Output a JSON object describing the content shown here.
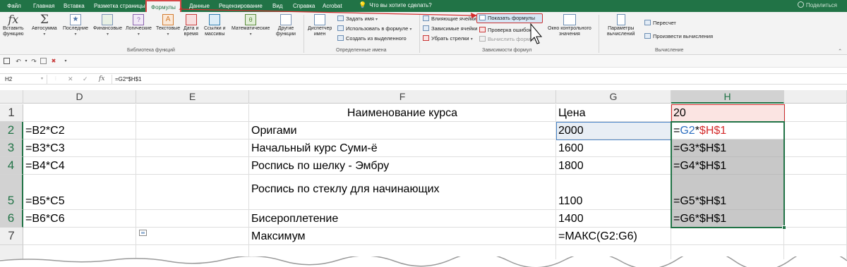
{
  "tabs": {
    "file": "Файл",
    "home": "Главная",
    "insert": "Вставка",
    "page_layout": "Разметка страницы",
    "formulas": "Формулы",
    "data": "Данные",
    "review": "Рецензирование",
    "view": "Вид",
    "help": "Справка",
    "acrobat": "Acrobat",
    "tell_me": "Что вы хотите сделать?",
    "share": "Поделиться"
  },
  "ribbon": {
    "function_library": {
      "label": "Библиотека функций",
      "insert_function": [
        "Вставить",
        "функцию"
      ],
      "autosum": [
        "Автосумма",
        ""
      ],
      "recent": [
        "Последние",
        ""
      ],
      "financial": [
        "Финансовые",
        ""
      ],
      "logical": [
        "Логические",
        ""
      ],
      "text": [
        "Текстовые",
        ""
      ],
      "datetime": [
        "Дата и",
        "время"
      ],
      "lookup": [
        "Ссылки и",
        "массивы"
      ],
      "math": [
        "Математические",
        ""
      ],
      "more": [
        "Другие",
        "функции"
      ]
    },
    "defined_names": {
      "label": "Определенные имена",
      "name_manager": [
        "Диспетчер",
        "имен"
      ],
      "define_name": "Задать имя",
      "use_in_formula": "Использовать в формуле",
      "create_from_selection": "Создать из выделенного"
    },
    "formula_auditing": {
      "label": "Зависимости формул",
      "trace_precedents": "Влияющие ячейки",
      "trace_dependents": "Зависимые ячейки",
      "remove_arrows": "Убрать стрелки",
      "show_formulas": "Показать формулы",
      "error_checking": "Проверка ошибок",
      "evaluate_formula": "Вычислить формулу",
      "watch_window": [
        "Окно контрольного",
        "значения"
      ]
    },
    "calculation": {
      "label": "Вычисление",
      "calc_options": [
        "Параметры",
        "вычислений"
      ],
      "calc_now": "Пересчет",
      "calc_sheet": "Произвести вычисления"
    }
  },
  "formula_bar": {
    "name_box": "H2",
    "fx": "fx",
    "formula": "=G2*$H$1"
  },
  "grid": {
    "columns": [
      "D",
      "E",
      "F",
      "G",
      "H"
    ],
    "rows": [
      "1",
      "2",
      "3",
      "4",
      "5",
      "6",
      "7"
    ],
    "cells": {
      "D2": "=B2*C2",
      "D3": "=B3*C3",
      "D4": "=B4*C4",
      "D5": "=B5*C5",
      "D6": "=B6*C6",
      "F1": "Наименование курса",
      "F2": "Оригами",
      "F3": "Начальный курс Суми-ё",
      "F4": "Роспись по шелку - Эмбру",
      "F5": "Роспись по стеклу для начинающих",
      "F6": "Бисероплетение",
      "F7": "Максимум",
      "G1": "Цена",
      "G2": "2000",
      "G3": "1600",
      "G4": "1800",
      "G5": "1100",
      "G6": "1400",
      "G7": "=МАКС(G2:G6)",
      "H1": "20",
      "H2": {
        "eq": "=",
        "ref1": "G2",
        "op": "*",
        "ref2": "$H$1"
      },
      "H3": "=G3*$H$1",
      "H4": "=G4*$H$1",
      "H5": "=G5*$H$1",
      "H6": "=G6*$H$1"
    }
  },
  "colors": {
    "excel_green": "#217346",
    "highlight_red": "#c93131",
    "ref_blue": "#2e6fc0",
    "ref_red": "#d42c2c"
  }
}
